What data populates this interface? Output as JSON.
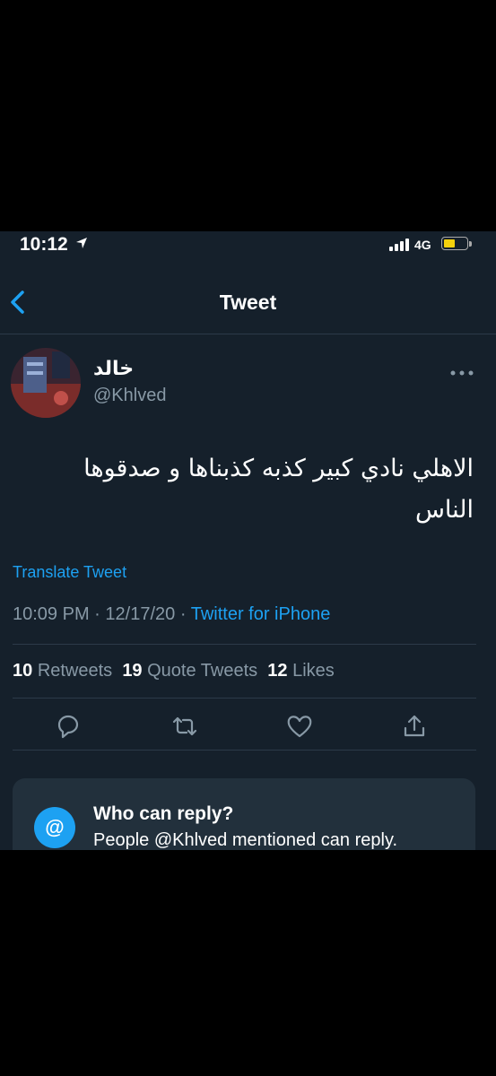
{
  "status_bar": {
    "time": "10:12",
    "network": "4G"
  },
  "nav": {
    "title": "Tweet"
  },
  "tweet": {
    "display_name": "خالد",
    "handle": "@Khlved",
    "text": "الاهلي نادي كبير كذبه كذبناها و صدقوها الناس",
    "translate_label": "Translate Tweet",
    "time": "10:09 PM",
    "date": "12/17/20",
    "separator": "·",
    "source": "Twitter for iPhone"
  },
  "stats": {
    "retweets_count": "10",
    "retweets_label": "Retweets",
    "quotes_count": "19",
    "quotes_label": "Quote Tweets",
    "likes_count": "12",
    "likes_label": "Likes"
  },
  "reply_settings": {
    "icon_text": "@",
    "title": "Who can reply?",
    "subtitle": "People @Khlved mentioned can reply."
  },
  "colors": {
    "background": "#15202b",
    "accent": "#1da1f2",
    "muted": "#8899a6",
    "divider": "#2c3a49",
    "battery": "#f5d10c"
  },
  "icons": [
    "location-arrow-icon",
    "signal-icon",
    "battery-icon",
    "back-chevron-icon",
    "more-icon",
    "reply-icon",
    "retweet-icon",
    "like-icon",
    "share-icon",
    "at-icon"
  ]
}
